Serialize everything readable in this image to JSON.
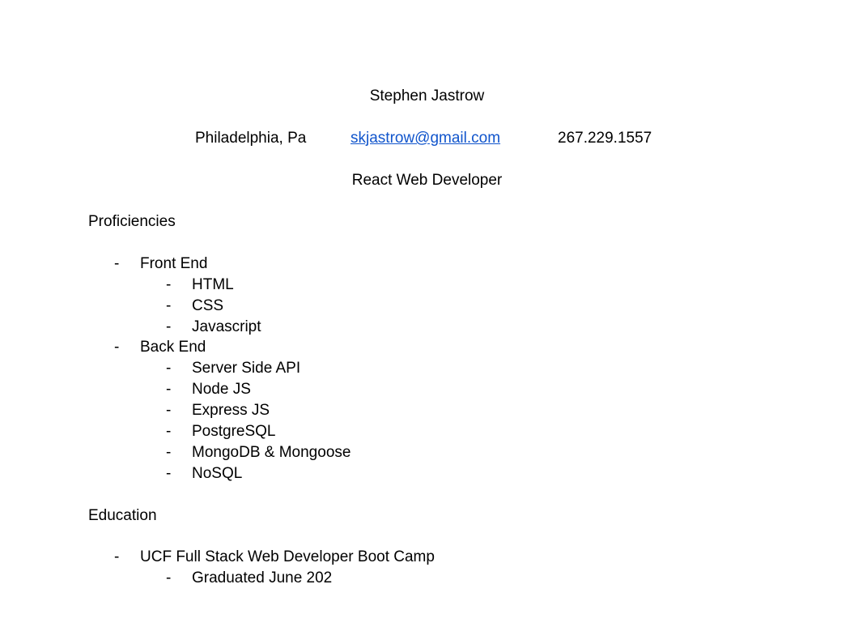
{
  "header": {
    "name": "Stephen Jastrow",
    "location": "Philadelphia, Pa",
    "email": "skjastrow@gmail.com",
    "phone": "267.229.1557",
    "role": "React Web Developer"
  },
  "bullet_marker": "-",
  "proficiencies": {
    "heading": "Proficiencies",
    "groups": [
      {
        "label": "Front End",
        "items": [
          "HTML",
          "CSS",
          "Javascript"
        ]
      },
      {
        "label": "Back End",
        "items": [
          "Server Side API",
          "Node JS",
          "Express JS",
          "PostgreSQL",
          "MongoDB & Mongoose",
          "NoSQL"
        ]
      }
    ]
  },
  "education": {
    "heading": "Education",
    "groups": [
      {
        "label": "UCF Full Stack Web Developer Boot Camp",
        "items": [
          "Graduated June 202"
        ]
      }
    ]
  }
}
